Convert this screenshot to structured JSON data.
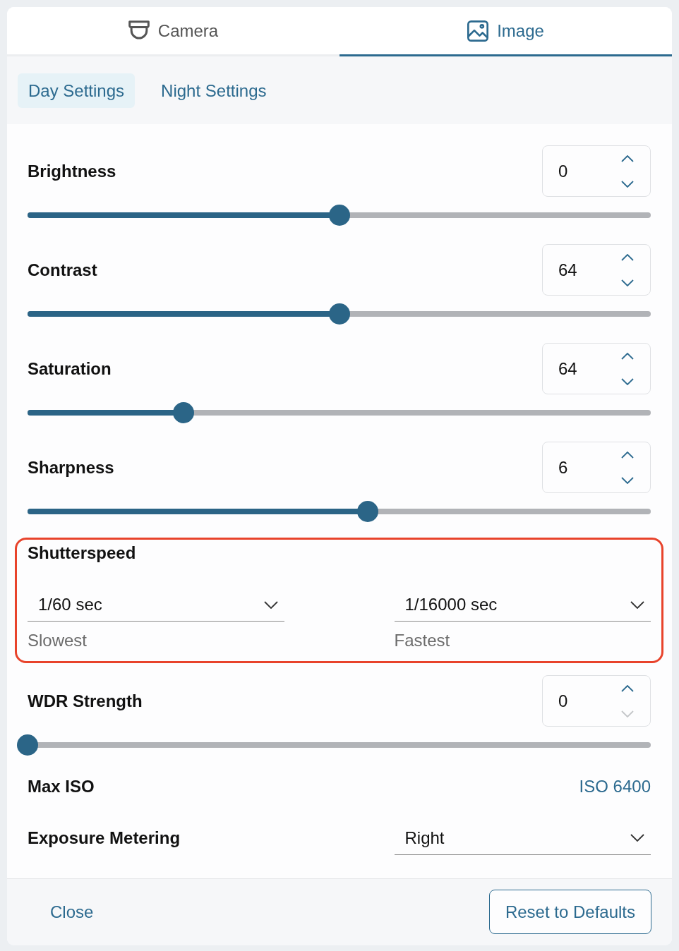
{
  "tabs": [
    {
      "label": "Camera",
      "selected": false
    },
    {
      "label": "Image",
      "selected": true
    }
  ],
  "subtabs": [
    {
      "label": "Day Settings",
      "selected": true
    },
    {
      "label": "Night Settings",
      "selected": false
    }
  ],
  "settings": [
    {
      "kind": "slider",
      "label": "Brightness",
      "value": "0",
      "level": 0.5,
      "decrement_disabled": false
    },
    {
      "kind": "slider",
      "label": "Contrast",
      "value": "64",
      "level": 0.5,
      "decrement_disabled": false
    },
    {
      "kind": "slider",
      "label": "Saturation",
      "value": "64",
      "level": 0.25,
      "decrement_disabled": false
    },
    {
      "kind": "slider",
      "label": "Sharpness",
      "value": "6",
      "level": 0.546,
      "decrement_disabled": false
    },
    {
      "kind": "range",
      "label": "Shutterspeed",
      "highlighted": true,
      "selects": [
        {
          "value": "1/60 sec",
          "caption": "Slowest"
        },
        {
          "value": "1/16000 sec",
          "caption": "Fastest"
        }
      ]
    },
    {
      "kind": "slider",
      "label": "WDR Strength",
      "value": "0",
      "level": 0,
      "decrement_disabled": true
    },
    {
      "kind": "link",
      "label": "Max ISO",
      "value": "ISO 6400"
    },
    {
      "kind": "select",
      "label": "Exposure Metering",
      "value": "Right"
    }
  ],
  "footer": {
    "close": "Close",
    "reset": "Reset to Defaults"
  }
}
